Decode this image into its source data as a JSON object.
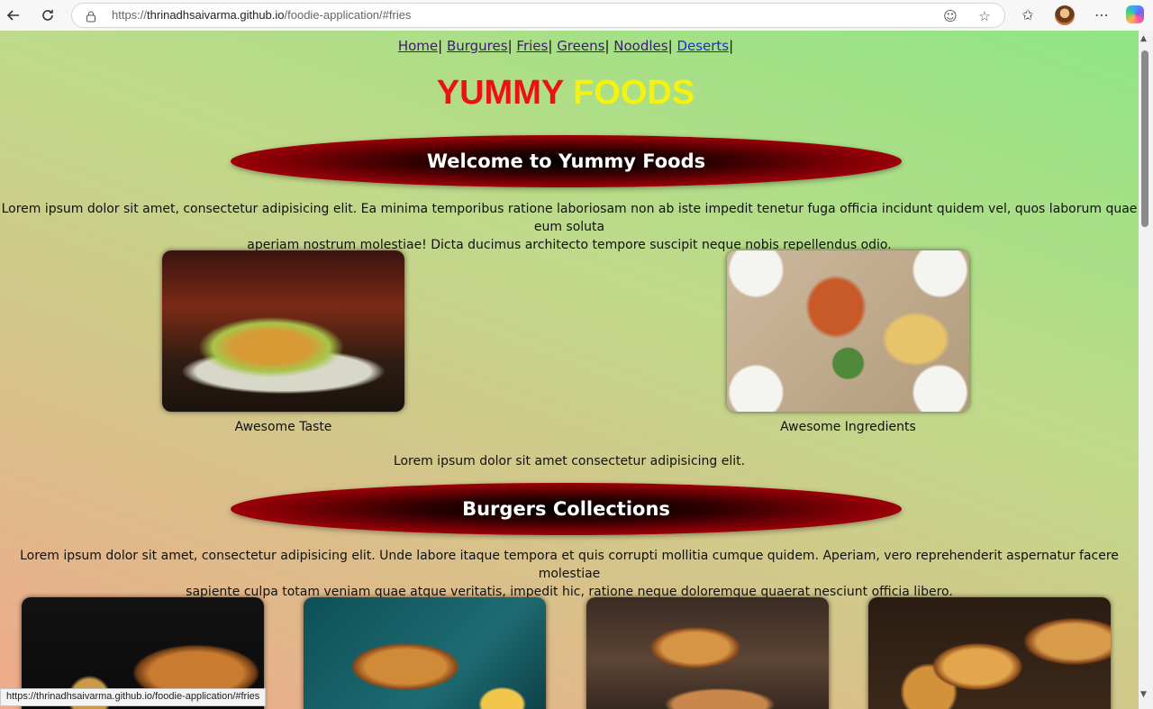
{
  "browser": {
    "url_prefix": "https://",
    "url_host": "thrinadhsaivarma.github.io",
    "url_path": "/foodie-application/#fries",
    "status_url": "https://thrinadhsaivarma.github.io/foodie-application/#fries"
  },
  "nav": {
    "items": [
      {
        "label": "Home"
      },
      {
        "label": "Burgures"
      },
      {
        "label": "Fries"
      },
      {
        "label": "Greens"
      },
      {
        "label": "Noodles"
      },
      {
        "label": "Deserts"
      }
    ],
    "separator": "|"
  },
  "brand": {
    "word1": "YUMMY",
    "word2": "FOODS"
  },
  "welcome": {
    "title": "Welcome to Yummy Foods",
    "text_line1": "Lorem ipsum dolor sit amet, consectetur adipisicing elit. Ea minima temporibus ratione laboriosam non ab iste impedit tenetur fuga officia incidunt quidem vel, quos laborum quae eum soluta",
    "text_line2": "aperiam nostrum molestiae! Dicta ducimus architecto tempore suscipit neque nobis repellendus odio."
  },
  "features": [
    {
      "caption": "Awesome Taste"
    },
    {
      "caption": "Awesome Ingredients"
    }
  ],
  "features_note": "Lorem ipsum dolor sit amet consectetur adipisicing elit.",
  "burgers": {
    "title": "Burgers Collections",
    "text_line1": "Lorem ipsum dolor sit amet, consectetur adipisicing elit. Unde labore itaque tempora et quis corrupti mollitia cumque quidem. Aperiam, vero reprehenderit aspernatur facere molestiae",
    "text_line2": "sapiente culpa totam veniam quae atque veritatis, impedit hic, ratione neque doloremque quaerat nesciunt officia libero."
  }
}
